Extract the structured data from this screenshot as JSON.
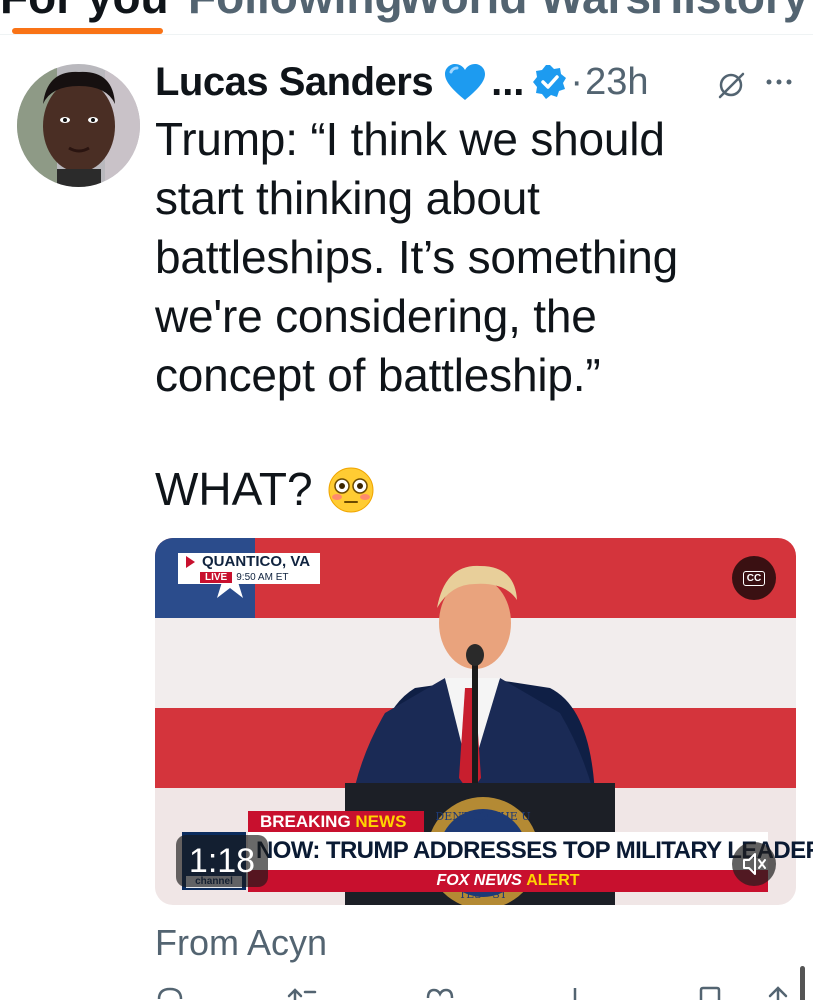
{
  "tabs": [
    {
      "label": "For you",
      "active": true
    },
    {
      "label": "Following",
      "active": false
    },
    {
      "label": "World Wars",
      "active": false
    },
    {
      "label": "History",
      "active": false
    }
  ],
  "post": {
    "display_name": "Lucas Sanders",
    "name_emoji": "blue-heart",
    "truncation": "...",
    "verified": true,
    "separator": "·",
    "time": "23h",
    "text_lines": [
      "Trump: “I think we should",
      "start thinking about",
      "battleships. It’s something",
      "we're considering, the",
      "concept of battleship.”"
    ],
    "closing_text": "WHAT?",
    "closing_emoji": "flushed-face",
    "source": "From Acyn"
  },
  "video": {
    "duration": "1:18",
    "cc_label": "CC",
    "overlay": {
      "location": "QUANTICO, VA",
      "live_label": "LIVE",
      "live_time": "9:50 AM ET",
      "breaking_label": "BREAKING",
      "breaking_news": "NEWS",
      "headline": "NOW: TRUMP ADDRESSES TOP MILITARY LEADERS",
      "alert_brand": "FOX NEWS",
      "alert_word": "ALERT",
      "channel_label": "channel"
    }
  },
  "colors": {
    "accent_tab": "#f97316",
    "verified_blue": "#1d9bf0",
    "secondary_text": "#536471",
    "fox_red": "#c8102e",
    "fox_yellow": "#ffd400"
  }
}
